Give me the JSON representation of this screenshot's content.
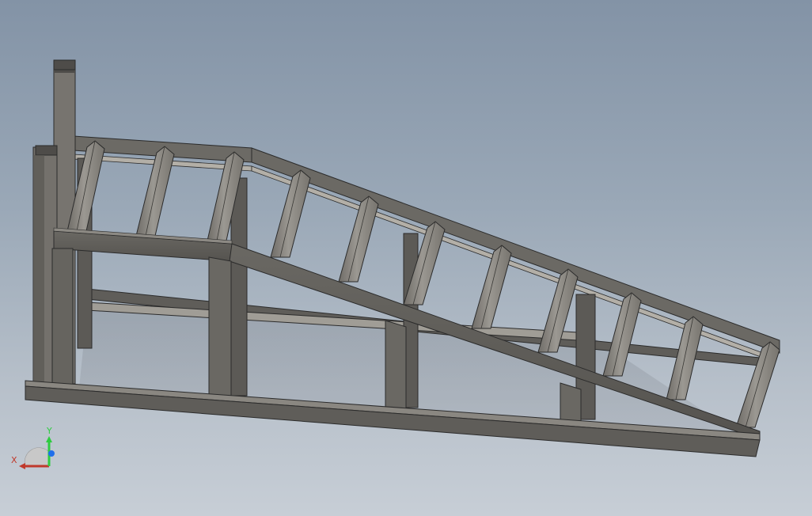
{
  "triad": {
    "x_label": "X",
    "y_label": "Y",
    "x_color": "#c0392b",
    "y_color": "#2ecc40",
    "z_color": "#1f6feb"
  },
  "model": {
    "description_icon": "steel-frame-ramp-3d-model",
    "steel_color": "#8a8781",
    "steel_dark": "#5d5b57",
    "steel_edge": "#2b2b2b"
  }
}
